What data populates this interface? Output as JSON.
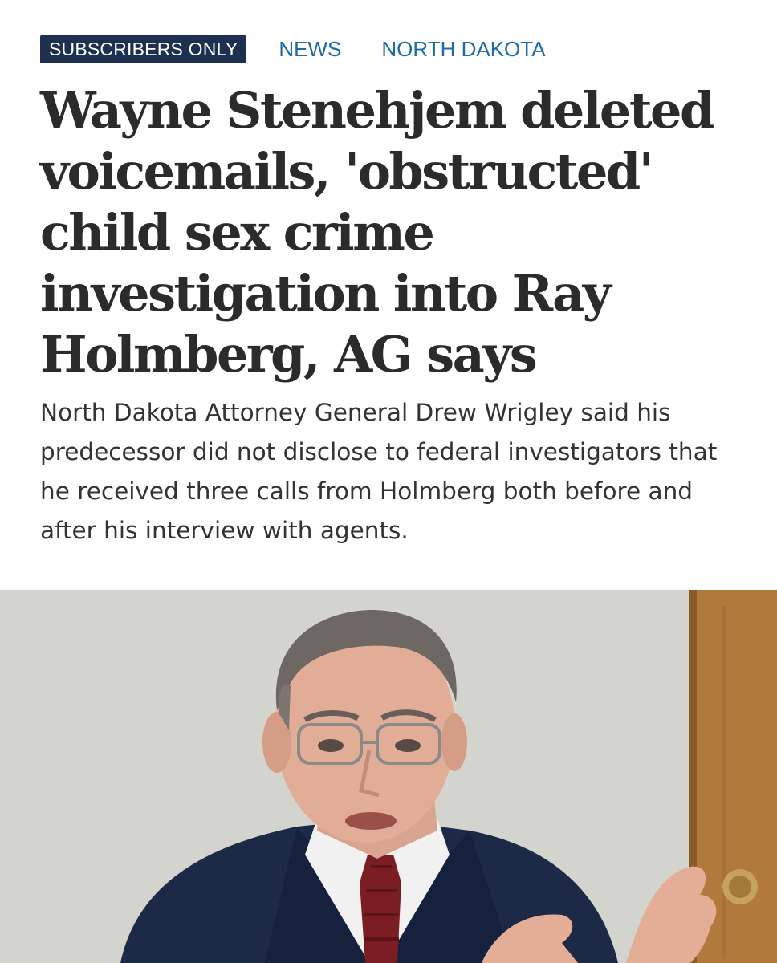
{
  "article": {
    "tags": {
      "badge": "SUBSCRIBERS ONLY",
      "links": [
        "NEWS",
        "NORTH DAKOTA"
      ]
    },
    "headline": "Wayne Stenehjem deleted voicemails, 'obstructed' child sex crime investigation into Ray Holmberg, AG says",
    "summary": "North Dakota Attorney General Drew Wrigley said his predecessor did not disclose to federal investigators that he received three calls from Holmberg both before and after his interview with agents."
  },
  "colors": {
    "badge_bg": "#1d3050",
    "link": "#1e6aa6",
    "headline": "#2b2b2b",
    "body_text": "#333333"
  }
}
